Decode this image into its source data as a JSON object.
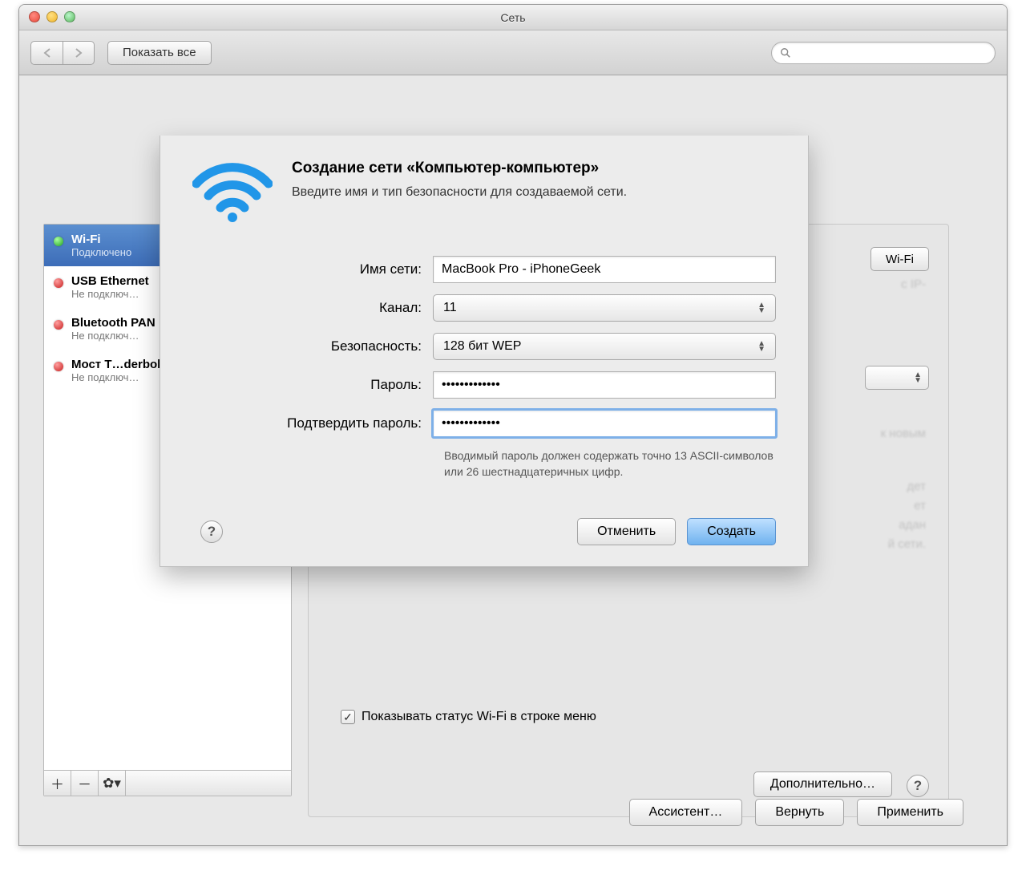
{
  "window": {
    "title": "Сеть"
  },
  "toolbar": {
    "show_all_label": "Показать все"
  },
  "sidebar": {
    "items": [
      {
        "name": "Wi-Fi",
        "status": "Подключено",
        "color": "green",
        "selected": true
      },
      {
        "name": "USB Ethernet",
        "status": "Не подключ…",
        "color": "red"
      },
      {
        "name": "Bluetooth PAN",
        "status": "Не подключ…",
        "color": "red"
      },
      {
        "name": "Мост T…derbolt",
        "status": "Не подключ…",
        "color": "red"
      }
    ]
  },
  "main": {
    "wifi_toggle_label": "Wi-Fi",
    "bg_ip_suffix": "с IP-",
    "bg_new_suffix": "к новым",
    "bg_dan": "адан",
    "bg_net": "й сети.",
    "bg_et": "ет",
    "bg_det": "дет",
    "show_status_label": "Показывать статус Wi-Fi в строке меню",
    "advanced_label": "Дополнительно…"
  },
  "bottom": {
    "assistant_label": "Ассистент…",
    "revert_label": "Вернуть",
    "apply_label": "Применить"
  },
  "sheet": {
    "title": "Создание сети «Компьютер-компьютер»",
    "subtitle": "Введите имя и тип безопасности для создаваемой сети.",
    "labels": {
      "name": "Имя сети:",
      "channel": "Канал:",
      "security": "Безопасность:",
      "password": "Пароль:",
      "confirm": "Подтвердить пароль:"
    },
    "values": {
      "name": "MacBook Pro - iPhoneGeek",
      "channel": "11",
      "security": "128 бит WEP",
      "password": "•••••••••••••",
      "confirm": "•••••••••••••"
    },
    "hint": "Вводимый пароль должен содержать точно 13 ASCII-символов или 26 шестнадцатеричных цифр.",
    "cancel_label": "Отменить",
    "create_label": "Создать"
  }
}
